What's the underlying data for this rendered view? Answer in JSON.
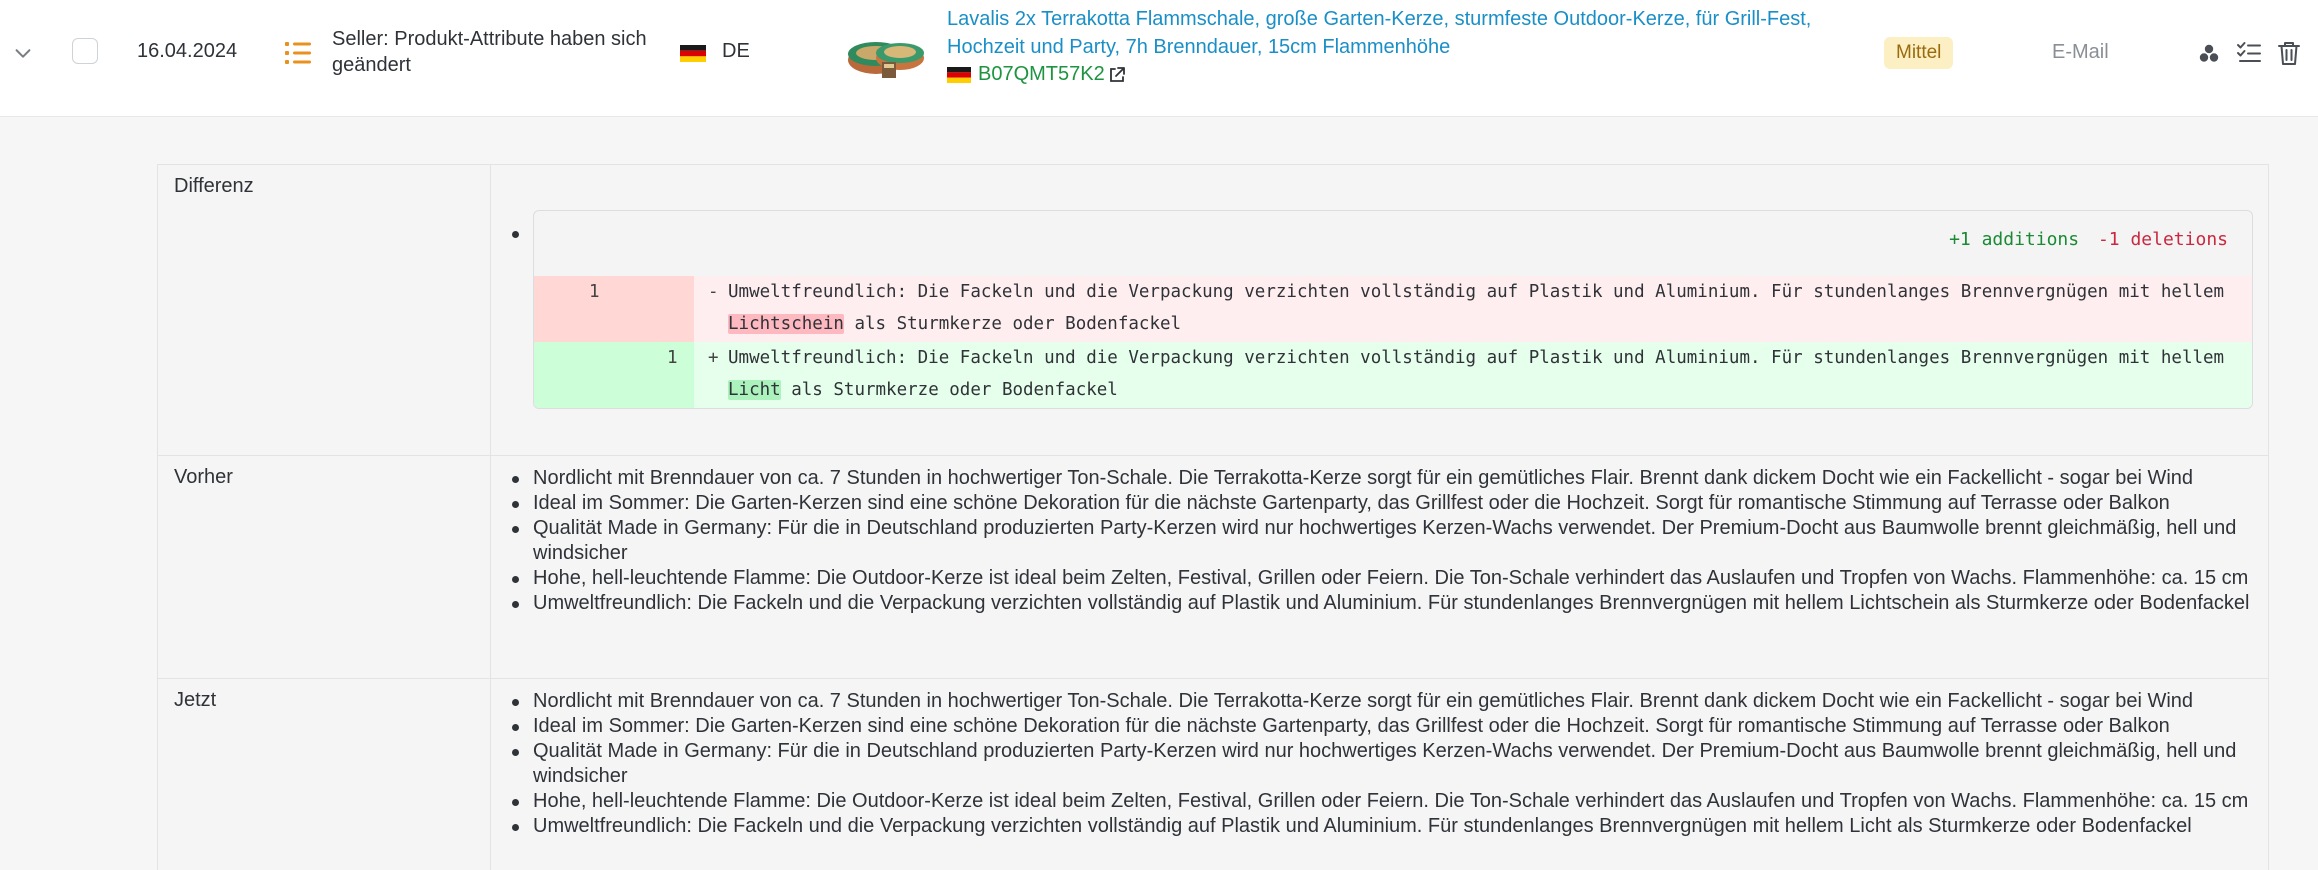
{
  "row": {
    "date": "16.04.2024",
    "event": "Seller: Produkt-Attribute haben sich geändert",
    "country": "DE",
    "product_title": "Lavalis 2x Terrakotta Flammschale, große Garten-Kerze, sturmfeste Outdoor-Kerze, für Grill-Fest, Hochzeit und Party, 7h Brenndauer, 15cm Flammenhöhe",
    "asin": "B07QMT57K2",
    "priority": "Mittel",
    "channel": "E-Mail",
    "colors": {
      "link": "#1a8fc7",
      "asin": "#1e9441",
      "event_icon": "#e8911c",
      "badge_bg": "#fcefc4",
      "badge_text": "#9a6a0c"
    },
    "icons": [
      "chevron-down-icon",
      "list-icon",
      "flag-de-icon",
      "external-link-icon",
      "users-icon",
      "checklist-icon",
      "trash-icon"
    ]
  },
  "detail": {
    "diff_label": "Differenz",
    "vorher_label": "Vorher",
    "jetzt_label": "Jetzt",
    "diff": {
      "additions": "+1 additions",
      "deletions": "-1 deletions",
      "deleted_line_no": "1",
      "added_line_no": "1",
      "deleted_sign": "-",
      "added_sign": "+",
      "deleted_prefix": "Umweltfreundlich: Die Fackeln und die Verpackung verzichten vollständig auf Plastik und Aluminium. Für stundenlanges Brennvergnügen mit hellem ",
      "deleted_word": "Lichtschein",
      "deleted_suffix": " als Sturmkerze oder Bodenfackel",
      "added_prefix": "Umweltfreundlich: Die Fackeln und die Verpackung verzichten vollständig auf Plastik und Aluminium. Für stundenlanges Brennvergnügen mit hellem ",
      "added_word": "Licht",
      "added_suffix": " als Sturmkerze oder Bodenfackel"
    },
    "vorher": [
      "Nordlicht mit Brenndauer von ca. 7 Stunden in hochwertiger Ton-Schale. Die Terrakotta-Kerze sorgt für ein gemütliches Flair. Brennt dank dickem Docht wie ein Fackellicht - sogar bei Wind",
      "Ideal im Sommer: Die Garten-Kerzen sind eine schöne Dekoration für die nächste Gartenparty, das Grillfest oder die Hochzeit. Sorgt für romantische Stimmung auf Terrasse oder Balkon",
      "Qualität Made in Germany: Für die in Deutschland produzierten Party-Kerzen wird nur hochwertiges Kerzen-Wachs verwendet. Der Premium-Docht aus Baumwolle brennt gleichmäßig, hell und windsicher",
      "Hohe, hell-leuchtende Flamme: Die Outdoor-Kerze ist ideal beim Zelten, Festival, Grillen oder Feiern. Die Ton-Schale verhindert das Auslaufen und Tropfen von Wachs. Flammenhöhe: ca. 15 cm",
      "Umweltfreundlich: Die Fackeln und die Verpackung verzichten vollständig auf Plastik und Aluminium. Für stundenlanges Brennvergnügen mit hellem Lichtschein als Sturmkerze oder Bodenfackel"
    ],
    "jetzt": [
      "Nordlicht mit Brenndauer von ca. 7 Stunden in hochwertiger Ton-Schale. Die Terrakotta-Kerze sorgt für ein gemütliches Flair. Brennt dank dickem Docht wie ein Fackellicht - sogar bei Wind",
      "Ideal im Sommer: Die Garten-Kerzen sind eine schöne Dekoration für die nächste Gartenparty, das Grillfest oder die Hochzeit. Sorgt für romantische Stimmung auf Terrasse oder Balkon",
      "Qualität Made in Germany: Für die in Deutschland produzierten Party-Kerzen wird nur hochwertiges Kerzen-Wachs verwendet. Der Premium-Docht aus Baumwolle brennt gleichmäßig, hell und windsicher",
      "Hohe, hell-leuchtende Flamme: Die Outdoor-Kerze ist ideal beim Zelten, Festival, Grillen oder Feiern. Die Ton-Schale verhindert das Auslaufen und Tropfen von Wachs. Flammenhöhe: ca. 15 cm",
      "Umweltfreundlich: Die Fackeln und die Verpackung verzichten vollständig auf Plastik und Aluminium. Für stundenlanges Brennvergnügen mit hellem Licht als Sturmkerze oder Bodenfackel"
    ]
  }
}
